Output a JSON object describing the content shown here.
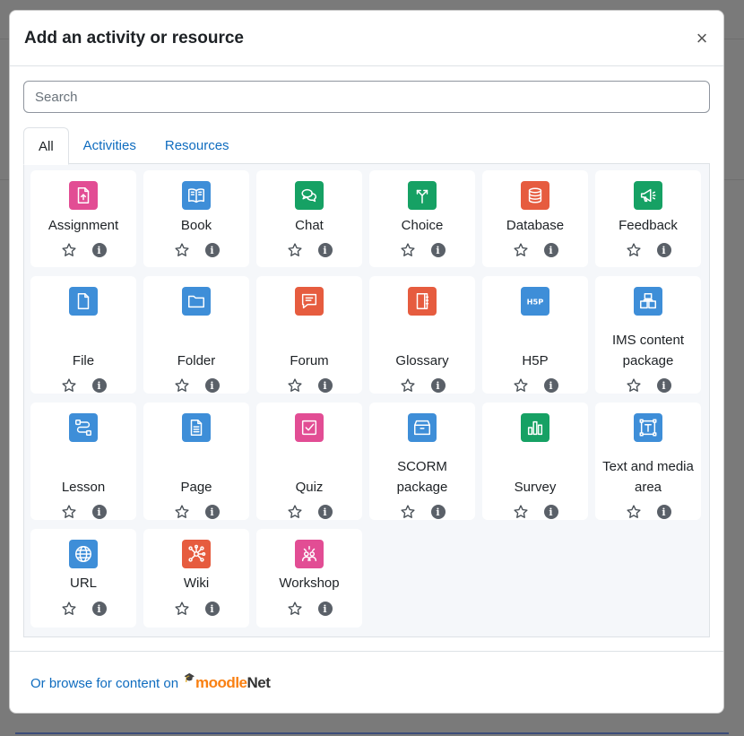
{
  "modal": {
    "title": "Add an activity or resource",
    "close_symbol": "×"
  },
  "search": {
    "placeholder": "Search",
    "value": ""
  },
  "tabs": [
    {
      "label": "All",
      "active": true
    },
    {
      "label": "Activities",
      "active": false
    },
    {
      "label": "Resources",
      "active": false
    }
  ],
  "items": [
    {
      "name": "Assignment",
      "icon": "assignment-icon",
      "color": "#e24d94"
    },
    {
      "name": "Book",
      "icon": "book-icon",
      "color": "#3e8ed8"
    },
    {
      "name": "Chat",
      "icon": "chat-icon",
      "color": "#16a164"
    },
    {
      "name": "Choice",
      "icon": "choice-icon",
      "color": "#16a164"
    },
    {
      "name": "Database",
      "icon": "database-icon",
      "color": "#e65c3f"
    },
    {
      "name": "Feedback",
      "icon": "feedback-icon",
      "color": "#16a164"
    },
    {
      "name": "File",
      "icon": "file-icon",
      "color": "#3e8ed8"
    },
    {
      "name": "Folder",
      "icon": "folder-icon",
      "color": "#3e8ed8"
    },
    {
      "name": "Forum",
      "icon": "forum-icon",
      "color": "#e65c3f"
    },
    {
      "name": "Glossary",
      "icon": "glossary-icon",
      "color": "#e65c3f"
    },
    {
      "name": "H5P",
      "icon": "h5p-icon",
      "color": "#3e8ed8"
    },
    {
      "name": "IMS content package",
      "icon": "ims-content-package-icon",
      "color": "#3e8ed8"
    },
    {
      "name": "Lesson",
      "icon": "lesson-icon",
      "color": "#3e8ed8"
    },
    {
      "name": "Page",
      "icon": "page-icon",
      "color": "#3e8ed8"
    },
    {
      "name": "Quiz",
      "icon": "quiz-icon",
      "color": "#e24d94"
    },
    {
      "name": "SCORM package",
      "icon": "scorm-package-icon",
      "color": "#3e8ed8"
    },
    {
      "name": "Survey",
      "icon": "survey-icon",
      "color": "#16a164"
    },
    {
      "name": "Text and media area",
      "icon": "text-media-area-icon",
      "color": "#3e8ed8"
    },
    {
      "name": "URL",
      "icon": "url-icon",
      "color": "#3e8ed8"
    },
    {
      "name": "Wiki",
      "icon": "wiki-icon",
      "color": "#e65c3f"
    },
    {
      "name": "Workshop",
      "icon": "workshop-icon",
      "color": "#e24d94"
    }
  ],
  "footer": {
    "browse_text": "Or browse for content on",
    "brand_part1": "moodle",
    "brand_part2": "Net"
  },
  "colors": {
    "link": "#0f6cbf",
    "moodle_orange": "#f98012"
  }
}
